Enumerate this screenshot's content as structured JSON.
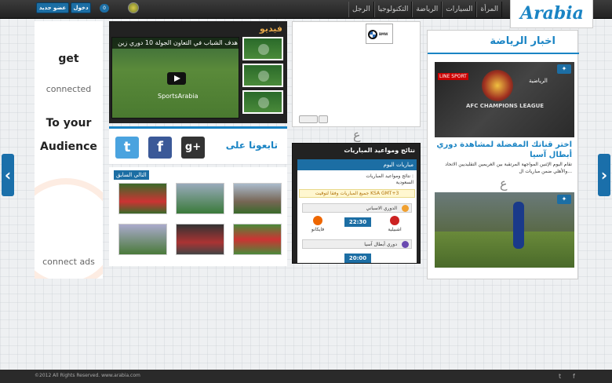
{
  "header": {
    "register": "عضو جديد",
    "login": "دخول",
    "notifications": "0",
    "nav": [
      "المرأة",
      "السيارات",
      "الرياضة",
      "التكنولوجيا",
      "الرجل"
    ],
    "logo": "Arabia"
  },
  "ad_left": {
    "line1": "get",
    "line2": "connected",
    "line3": "To your",
    "line4": "Audience",
    "brand": "connect ads"
  },
  "video": {
    "heading": "فيديو",
    "title": "هدف الشباب في التعاون الجولة 10 دوري زين",
    "brand": "SportsArabia"
  },
  "follow": {
    "label": "تابعونا على"
  },
  "gallery": {
    "tab": "التالي السابق"
  },
  "ad_mid": {
    "logo_text": "BMW"
  },
  "matches": {
    "heading": "نتائج ومواعيد المباريات",
    "tab": "مباريات اليوم",
    "line1": "نتائج ومواعيد المباريات :",
    "line2": "السعودية",
    "note": "جميع المباريات وفقا لتوقيت KSA GMT+3",
    "league1": "الدوري الاسباني",
    "m1_time": "22:30",
    "m1_home": "اشبيلية",
    "m1_away": "فايكانو",
    "league2": "دوري أبطال آسيا",
    "m2_time": "20:00"
  },
  "news": {
    "heading": "اخبار الرياضة",
    "title": "اختر قناتك المفضلة لمشاهدة دوري أبطال آسيا",
    "text": "تقام اليوم الإثنين المواجهة المرتقبة بين الغريمين التقليديين الاتحاد والأهلي ضمن مباريات ال...",
    "img_text1": "AFC CHAMPIONS LEAGUE",
    "img_text2": "الرياضية",
    "img_text3": "LINE SPORT"
  },
  "footer": {
    "copyright": "©2012 All Rights Reserved. www.arabia.com"
  }
}
